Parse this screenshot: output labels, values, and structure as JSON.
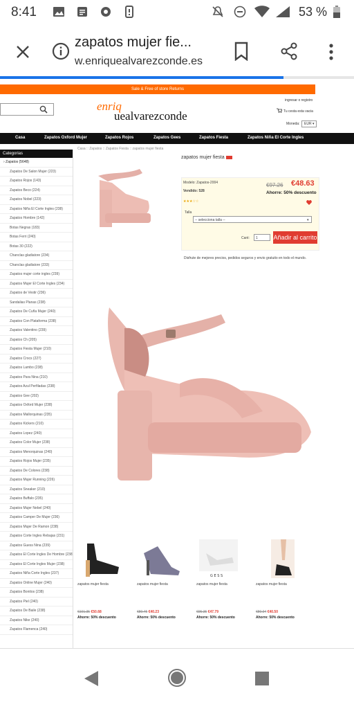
{
  "status_bar": {
    "time": "8:41",
    "battery": "53 %"
  },
  "browser": {
    "title": "zapatos mujer fie...",
    "domain": "w.enriquealvarezconde.es",
    "progress_fraction": 0.8
  },
  "site": {
    "promo": "Sale & Free of store Returns",
    "logo_top": "enriq",
    "logo_bottom": "uealvarezconde",
    "account": "ingresar o registro",
    "cart": "Tu cesta esta vacia",
    "currency_label": "Moneda:",
    "currency": "EUR",
    "nav": [
      "Casa",
      "Zapatos Oxford Mujer",
      "Zapatos Rojos",
      "Zapatos Gees",
      "Zapatos Fiesta",
      "Zapatos Niña El Corte Ingles"
    ]
  },
  "sidebar": {
    "header": "Categorias",
    "items": [
      "Zapatos (5648)",
      "Zapatos De Salon Mujer (223)",
      "Zapatos Rojos (143)",
      "Zapatos Beco (224)",
      "Zapatos Nobel (223)",
      "Zapatos Niña El Corte Ingles (238)",
      "Zapatos Hombre (142)",
      "Botas Negras (183)",
      "Botas Ferri (240)",
      "Botas 30 (222)",
      "Chanclas gladiatore (234)",
      "Chanclas gladiatore (233)",
      "Zapatos mujer corte ingles (239)",
      "Zapatos Mujer El Corte Ingles (234)",
      "Zapatos de Vestir (236)",
      "Sandalias Planas (238)",
      "Zapatos De Cuña Mujer (240)",
      "Zapatos Con Plataforma (238)",
      "Zapatos Valentino (239)",
      "Zapatos Ch (205)",
      "Zapatos Fiesta Mujer (210)",
      "Zapatos Crocs (227)",
      "Zapatos Lambo (238)",
      "Zapatos Para Nina (210)",
      "Zapatos Azul Perfiladas (238)",
      "Zapatos Gee (202)",
      "Zapatos Oxford Mujer (238)",
      "Zapatos Mallorquinas (235)",
      "Zapatos Kickers (210)",
      "Zapatos Lopez (240)",
      "Zapatos Color Mujer (238)",
      "Zapatos Menorquinas (240)",
      "Zapatos Rojos Mujer (235)",
      "Zapatos De Colores (238)",
      "Zapatos Mujer Running (226)",
      "Zapatos Sneaker (210)",
      "Zapatos Buffalo (235)",
      "Zapatos Mujer Nebel (240)",
      "Zapatos Camper De Mujer (236)",
      "Zapatos Mujer De Ramon (238)",
      "Zapatos Corte Ingles Rebajas (231)",
      "Zapatos Guess Nina (239)",
      "Zapatos El Corte Ingles De Hombre (238)",
      "Zapatos El Corte Ingles Mujer (238)",
      "Zapatos Niña Corte Ingles (237)",
      "Zapatos Online Mujer (240)",
      "Zapatos Bonitos (238)",
      "Zapatos Piel (240)",
      "Zapatos De Baile (238)",
      "Zapatos Nike (240)",
      "Zapatos Flamenca (240)"
    ]
  },
  "product": {
    "breadcrumb": "Casa :: Zapatos :: Zapatos Fiesta :: zapatos mujer fiesta",
    "title": "zapatos mujer fiesta",
    "model_label": "Modelo: Zapatos-2004",
    "sold_label": "Vendido: 528",
    "old_price": "€97.26",
    "new_price": "€48.63",
    "discount": "Ahorre: 50% descuento",
    "size_label": "Talla",
    "size_placeholder": "-- selecciona talla --",
    "qty_label": "Cant:",
    "qty": "1",
    "add_button": "Añadir al carrito",
    "note": "Disfrute de mejores precios, pedidos seguros y envio gratuito en todo el mundo."
  },
  "related": [
    {
      "name": "zapatos mujer fiesta",
      "old": "€101.35",
      "new": "€50.68",
      "disc": "Ahorre: 50% descuento"
    },
    {
      "name": "zapatos mujer fiesta",
      "old": "€80.45",
      "new": "€40.23",
      "disc": "Ahorre: 50% descuento"
    },
    {
      "name": "zapatos mujer fiesta",
      "old": "€95.35",
      "new": "€47.79",
      "disc": "Ahorre: 50% descuento"
    },
    {
      "name": "zapatos mujer fiesta",
      "old": "€80.94",
      "new": "€40.50",
      "disc": "Ahorre: 50% descuento"
    }
  ],
  "colors": {
    "accent": "#ff6a00",
    "progress": "#1a73e8",
    "price_red": "#e03c31"
  }
}
